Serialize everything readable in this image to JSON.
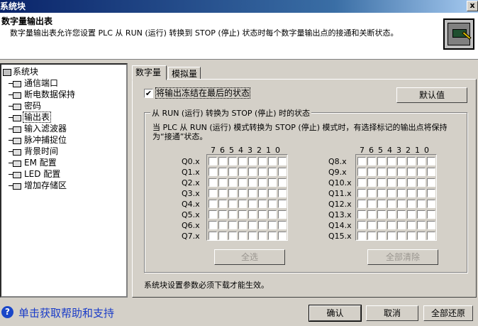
{
  "window": {
    "title": "系统块",
    "close": "x"
  },
  "header": {
    "title": "数字量输出表",
    "description": "数字量输出表允许您设置 PLC 从 RUN (运行) 转换到 STOP (停止) 状态时每个数字量输出点的接通和关断状态。",
    "icon": "output-table-icon"
  },
  "tree": {
    "root": "系统块",
    "items": [
      "通信端口",
      "断电数据保持",
      "密码",
      "输出表",
      "输入滤波器",
      "脉冲捕捉位",
      "背景时间",
      "EM 配置",
      "LED 配置",
      "增加存储区"
    ],
    "selected": "输出表"
  },
  "tabs": [
    "数字量",
    "模拟量"
  ],
  "panel": {
    "freeze_label": "将输出冻结在最后的状态",
    "freeze_checked": true,
    "default_button": "默认值",
    "group_title": "从 RUN (运行) 转换为 STOP (停止) 时的状态",
    "group_desc": "当 PLC 从 RUN (运行) 模式转换为 STOP (停止) 模式时，有选择标记的输出点将保持为“接通”状态。",
    "bit_headers": [
      "7",
      "6",
      "5",
      "4",
      "3",
      "2",
      "1",
      "0"
    ],
    "left_rows": [
      "Q0.x",
      "Q1.x",
      "Q2.x",
      "Q3.x",
      "Q4.x",
      "Q5.x",
      "Q6.x",
      "Q7.x"
    ],
    "right_rows": [
      "Q8.x",
      "Q9.x",
      "Q10.x",
      "Q11.x",
      "Q12.x",
      "Q13.x",
      "Q14.x",
      "Q15.x"
    ],
    "select_all": "全选",
    "clear_all": "全部清除",
    "note": "系统块设置参数必须下载才能生效。"
  },
  "footer": {
    "help": "单击获取帮助和支持",
    "ok": "确认",
    "cancel": "取消",
    "restore": "全部还原"
  }
}
